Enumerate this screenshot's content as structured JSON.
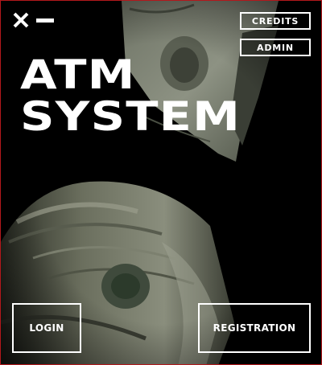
{
  "app": {
    "title_line1": "ATM",
    "title_line2": "SYSTEM"
  },
  "window_controls": {
    "close_icon": "close-icon",
    "minimize_icon": "minimize-icon"
  },
  "header": {
    "credits_label": "CREDITS",
    "admin_label": "ADMIN"
  },
  "footer": {
    "login_label": "LOGIN",
    "registration_label": "REGISTRATION"
  },
  "colors": {
    "background": "#000000",
    "text": "#ffffff",
    "window_border": "#b3181c"
  }
}
